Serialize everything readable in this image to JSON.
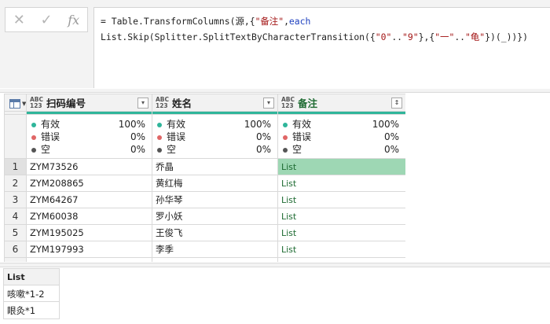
{
  "formula_bar": {
    "cancel_icon": "close-icon",
    "confirm_icon": "check-icon",
    "fx_label": "fx",
    "line1": {
      "prefix": "= Table.TransformColumns(源,{",
      "string": "\"备注\"",
      "comma": ",",
      "keyword": "each"
    },
    "line2": {
      "a": "List.Skip(Splitter.SplitTextByCharacterTransition({",
      "s1": "\"0\"",
      "b": "..",
      "s2": "\"9\"",
      "c": "},{",
      "s3": "\"一\"",
      "d": "..",
      "s4": "\"龟\"",
      "e": "})(_))})"
    }
  },
  "table": {
    "columns": [
      {
        "type_top": "ABC",
        "type_bottom": "123",
        "name": "扫码编号"
      },
      {
        "type_top": "ABC",
        "type_bottom": "123",
        "name": "姓名"
      },
      {
        "type_top": "ABC",
        "type_bottom": "123",
        "name": "备注"
      }
    ],
    "quality": [
      {
        "valid_label": "有效",
        "valid_pct": "100%",
        "error_label": "错误",
        "error_pct": "0%",
        "empty_label": "空",
        "empty_pct": "0%"
      },
      {
        "valid_label": "有效",
        "valid_pct": "100%",
        "error_label": "错误",
        "error_pct": "0%",
        "empty_label": "空",
        "empty_pct": "0%"
      },
      {
        "valid_label": "有效",
        "valid_pct": "100%",
        "error_label": "错误",
        "error_pct": "0%",
        "empty_label": "空",
        "empty_pct": "0%"
      }
    ],
    "rows": [
      {
        "num": "1",
        "code": "ZYM73526",
        "name": "乔晶",
        "note": "List"
      },
      {
        "num": "2",
        "code": "ZYM208865",
        "name": "黄红梅",
        "note": "List"
      },
      {
        "num": "3",
        "code": "ZYM64267",
        "name": "孙华琴",
        "note": "List"
      },
      {
        "num": "4",
        "code": "ZYM60038",
        "name": "罗小妖",
        "note": "List"
      },
      {
        "num": "5",
        "code": "ZYM195025",
        "name": "王俊飞",
        "note": "List"
      },
      {
        "num": "6",
        "code": "ZYM197993",
        "name": "李季",
        "note": "List"
      }
    ]
  },
  "preview": {
    "header": "List",
    "items": [
      "咳嗽*1-2",
      "眼灸*1"
    ]
  },
  "colors": {
    "quality_bar": "#2fb59a",
    "selected_cell": "#9ed7b4",
    "list_text": "#1e6b32",
    "keyword": "#1d3fbf",
    "string": "#a31515"
  }
}
